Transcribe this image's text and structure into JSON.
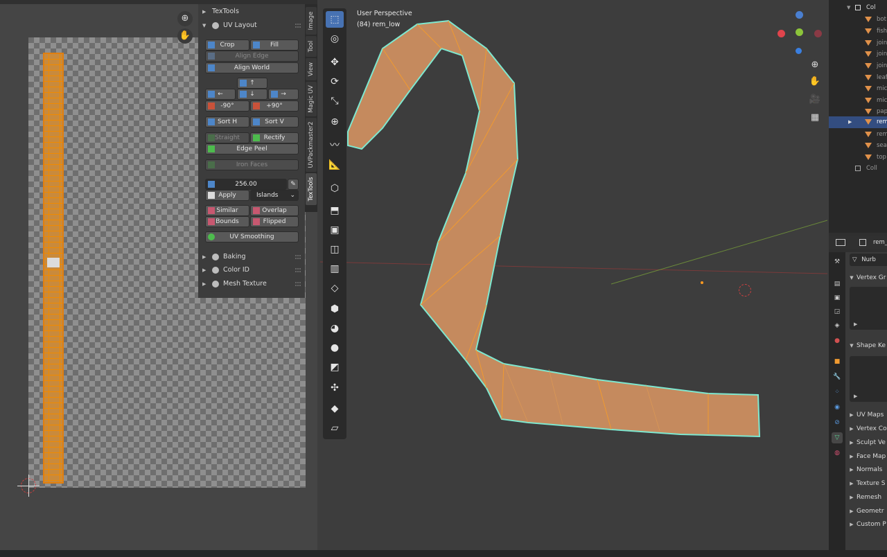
{
  "uv_editor": {
    "zoom_icon": "zoom-in-icon",
    "pan_icon": "hand-icon"
  },
  "texpanel": {
    "texttools_header": "TexTools",
    "uv_layout_header": "UV Layout",
    "buttons": {
      "crop": "Crop",
      "fill": "Fill",
      "align_edge": "Align Edge",
      "align_world": "Align World",
      "up": "↑",
      "left": "←",
      "down": "↓",
      "right": "→",
      "rot_neg": "-90°",
      "rot_pos": "+90°",
      "sort_h": "Sort H",
      "sort_v": "Sort V",
      "straight": "Straight",
      "rectify": "Rectify",
      "edge_peel": "Edge Peel",
      "iron_faces": "Iron Faces",
      "texel_value": "256.00",
      "apply": "Apply",
      "islands": "Islands",
      "similar": "Similar",
      "overlap": "Overlap",
      "bounds": "Bounds",
      "flipped": "Flipped",
      "uv_smoothing": "UV Smoothing"
    },
    "sections": {
      "baking": "Baking",
      "color_id": "Color ID",
      "mesh_texture": "Mesh Texture"
    }
  },
  "vertical_tabs": [
    "Image",
    "Tool",
    "View",
    "Magic UV",
    "UVPackmaster2",
    "TexTools"
  ],
  "viewport": {
    "title": "User Perspective",
    "object_info": "(84) rem_low"
  },
  "outliner": {
    "collection": "Col",
    "items": [
      "bot",
      "fish",
      "join",
      "join",
      "join",
      "leaf",
      "mic",
      "mic",
      "pap",
      "rem",
      "rem",
      "sea",
      "top"
    ],
    "selected_index": 9,
    "last_collection": "Coll"
  },
  "properties": {
    "header_label": "rem_",
    "type_label": "Nurb",
    "sections": [
      "Vertex Gr",
      "Shape Ke",
      "UV Maps",
      "Vertex Co",
      "Sculpt Ve",
      "Face Map",
      "Normals",
      "Texture S",
      "Remesh",
      "Geometr",
      "Custom P"
    ]
  },
  "colors": {
    "accent": "#4772b3",
    "uv_island": "#e07f10",
    "mesh": "#c98a50",
    "selection_outline": "#7ee8d0"
  }
}
